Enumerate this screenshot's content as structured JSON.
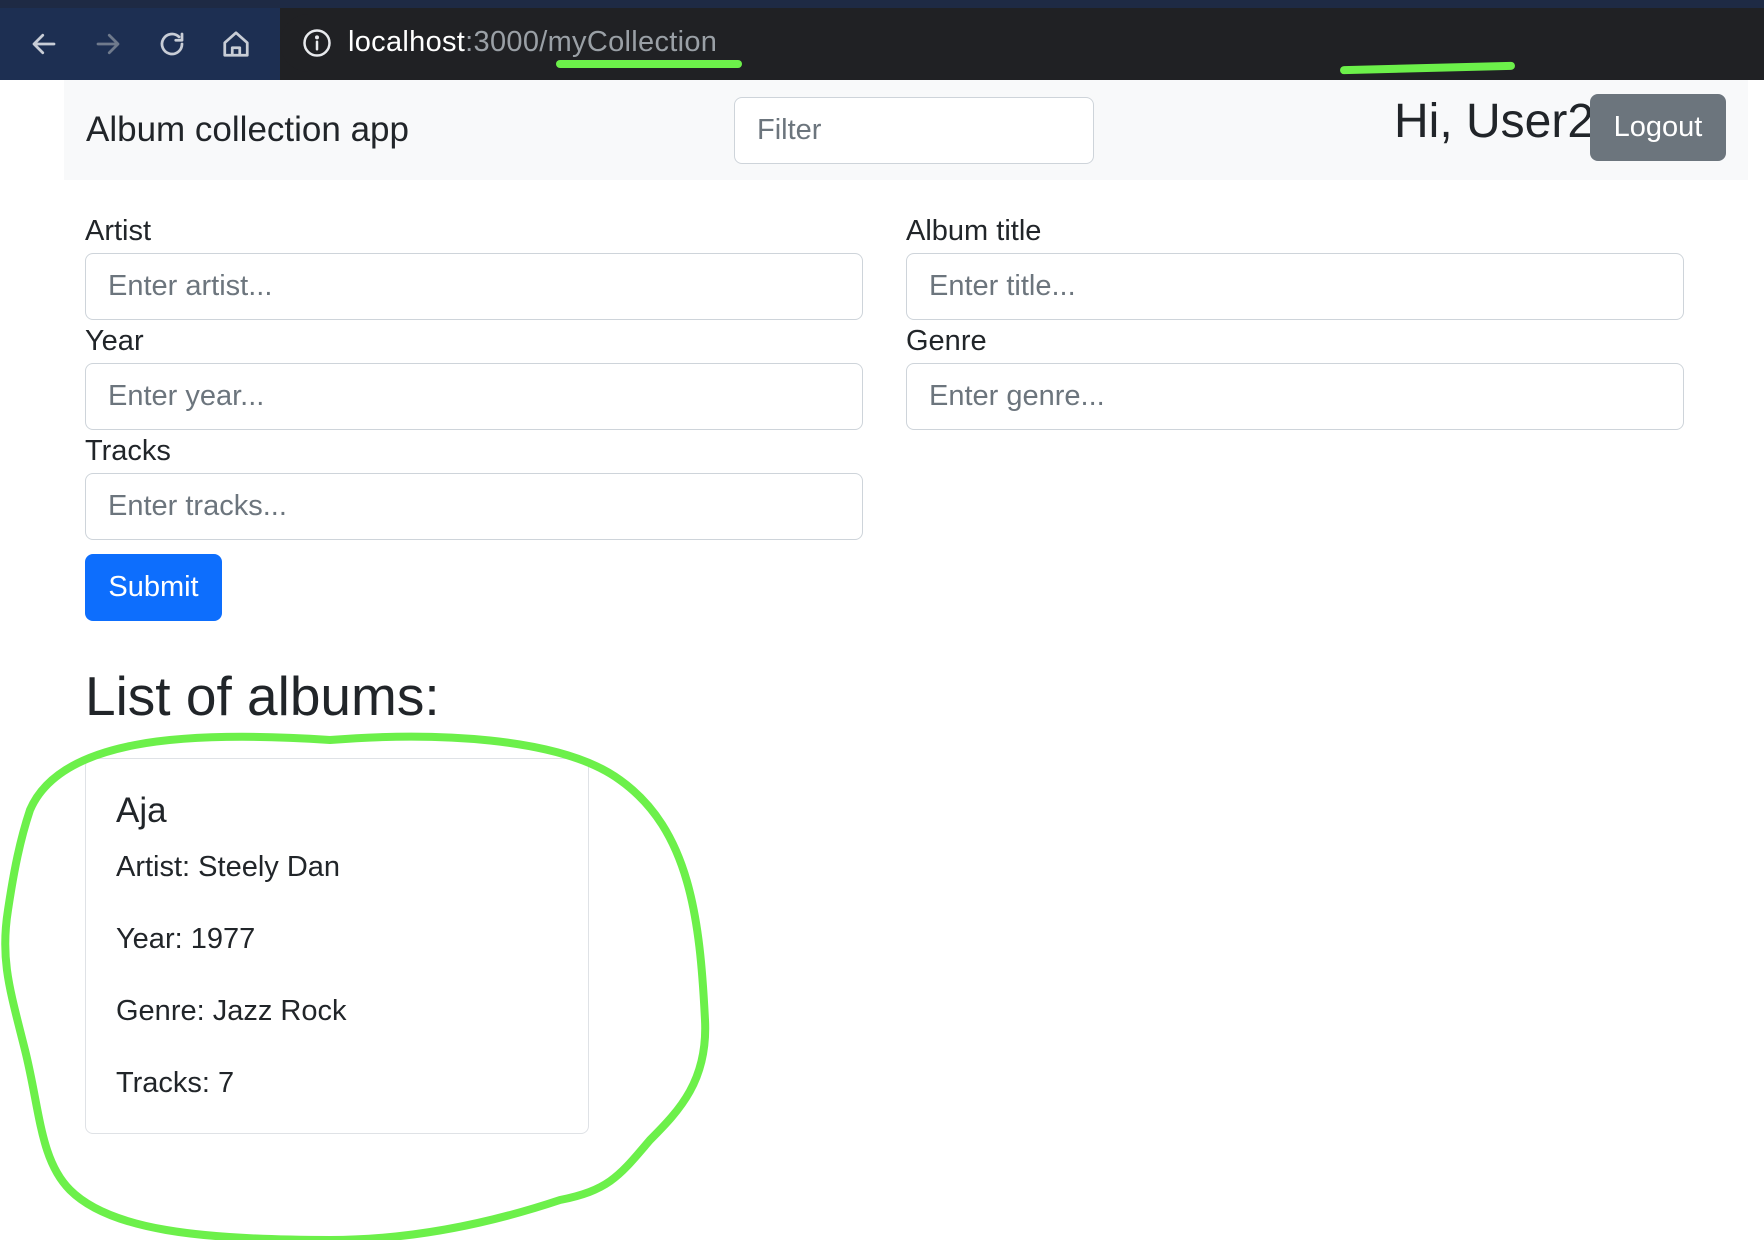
{
  "browser": {
    "url_host": "localhost",
    "url_rest": ":3000/myCollection"
  },
  "navbar": {
    "brand": "Album collection app",
    "filter_placeholder": "Filter",
    "greeting": "Hi, User2",
    "logout_label": "Logout"
  },
  "form": {
    "artist_label": "Artist",
    "artist_placeholder": "Enter artist...",
    "title_label": "Album title",
    "title_placeholder": "Enter title...",
    "year_label": "Year",
    "year_placeholder": "Enter year...",
    "genre_label": "Genre",
    "genre_placeholder": "Enter genre...",
    "tracks_label": "Tracks",
    "tracks_placeholder": "Enter tracks...",
    "submit_label": "Submit"
  },
  "list": {
    "heading": "List of albums:",
    "albums": [
      {
        "title": "Aja",
        "artist": "Artist: Steely Dan",
        "year": "Year: 1977",
        "genre": "Genre: Jazz Rock",
        "tracks": "Tracks: 7"
      }
    ]
  },
  "annotations": {
    "color": "#6cf04a"
  }
}
